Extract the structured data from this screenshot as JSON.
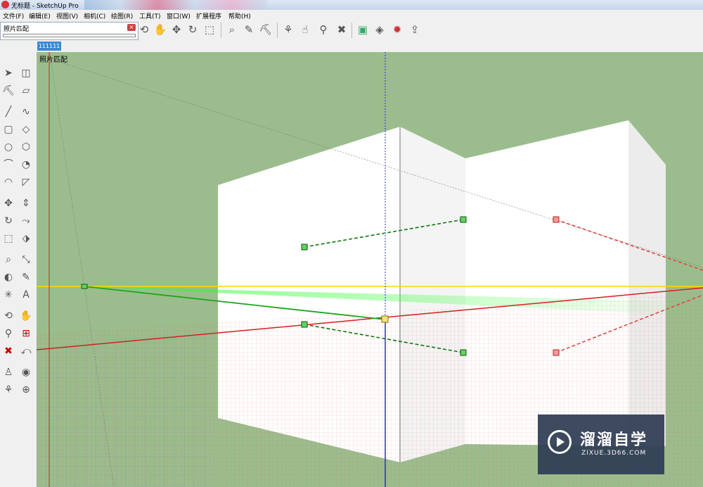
{
  "window": {
    "title": "无标题 - SketchUp Pro"
  },
  "menu": [
    "文件(F)",
    "编辑(E)",
    "视图(V)",
    "相机(C)",
    "绘图(R)",
    "工具(T)",
    "窗口(W)",
    "扩展程序",
    "帮助(H)"
  ],
  "dialog": {
    "title": "照片匹配",
    "close_icon": "close-icon"
  },
  "scene_tab": {
    "label": "111111"
  },
  "viewport": {
    "label": "照片匹配",
    "background": "#9bbd8d"
  },
  "top_tools": [
    "orbit-icon",
    "pan-icon",
    "move-icon",
    "rotate-icon",
    "scale-icon",
    "tape-icon",
    "text-icon",
    "paint-icon",
    "walk-icon",
    "lookaround-icon",
    "zoom-icon",
    "zoom-extents-icon",
    "component-icon",
    "warehouse-icon",
    "extension-icon",
    "share-icon"
  ],
  "left_tools": [
    "select-icon",
    "component-icon",
    "paint-icon",
    "eraser-icon",
    "line-icon",
    "freehand-icon",
    "rectangle-icon",
    "rotated-rect-icon",
    "circle-icon",
    "polygon-icon",
    "arc-icon",
    "pie-icon",
    "arc3-icon",
    "offset-face-icon",
    "move-icon",
    "pushpull-icon",
    "rotate-icon",
    "followme-icon",
    "scale-icon",
    "offset-icon",
    "tape-icon",
    "dimension-icon",
    "protractor-icon",
    "text-icon",
    "axes-icon",
    "3dtext-icon",
    "orbit-icon",
    "pan-icon",
    "zoom-icon",
    "zoom-window-icon",
    "zoom-extents-icon",
    "previous-icon",
    "position-camera-icon",
    "lookaround-icon",
    "walk-icon",
    "section-icon"
  ],
  "watermark": {
    "title": "溜溜自学",
    "subtitle": "ZIXUE.3D66.COM"
  }
}
